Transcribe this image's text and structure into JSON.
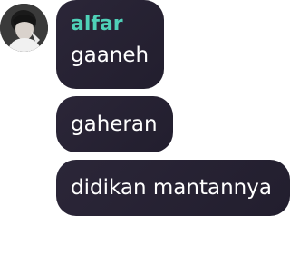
{
  "chat": {
    "sender": {
      "name": "alfar",
      "name_color": "#4fd1b8",
      "avatar_icon": "profile-photo"
    },
    "messages": [
      {
        "text": "gaaneh"
      },
      {
        "text": "gaheran"
      },
      {
        "text": "didikan mantannya"
      }
    ],
    "bubble_color": "#2b2638"
  }
}
